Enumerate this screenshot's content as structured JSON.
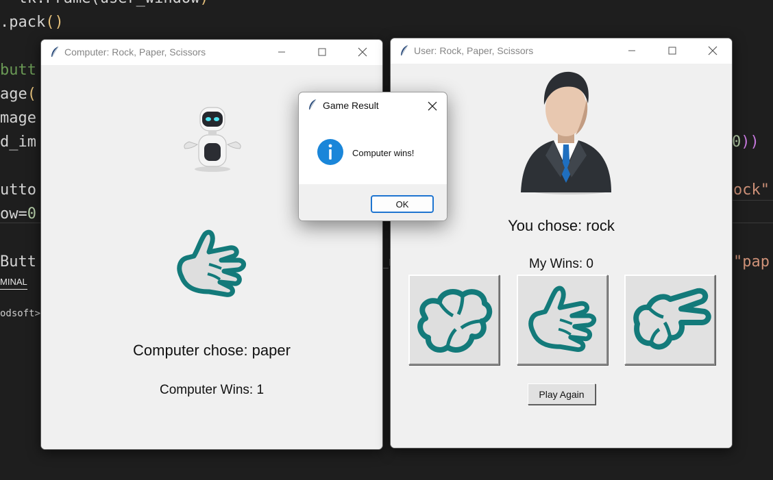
{
  "background_code": {
    "lines": [
      {
        "parts": [
          [
            "= tk.Frame(",
            "w"
          ],
          [
            "user_window",
            "w"
          ],
          [
            ")",
            "y"
          ]
        ]
      },
      {
        "parts": [
          [
            ".pack",
            "w"
          ],
          [
            "()",
            "y"
          ]
        ]
      },
      {
        "parts": [
          [
            "",
            "w"
          ]
        ]
      },
      {
        "parts": [
          [
            "butt",
            "g"
          ]
        ]
      },
      {
        "parts": [
          [
            "age",
            "w"
          ],
          [
            "(",
            "y"
          ]
        ]
      },
      {
        "parts": [
          [
            "mage",
            "w"
          ]
        ]
      },
      {
        "parts": [
          [
            "d_im",
            "w"
          ]
        ]
      },
      {
        "parts": [
          [
            "",
            "w"
          ]
        ]
      },
      {
        "parts": [
          [
            "utto",
            "w"
          ]
        ]
      },
      {
        "parts": [
          [
            "ow=",
            "w"
          ],
          [
            "0",
            "n"
          ]
        ]
      },
      {
        "parts": [
          [
            "",
            "w"
          ]
        ]
      },
      {
        "parts": [
          [
            "Butt",
            "w"
          ]
        ]
      }
    ],
    "right_fragments": [
      {
        "text": "0",
        "cls": "n",
        "paren": "))"
      },
      {
        "text": "ock\"",
        "cls": "o"
      },
      {
        "text": "\"pap",
        "cls": "o"
      }
    ],
    "mid_fragment": "_n",
    "terminal_tab": "MINAL",
    "terminal_text": "odsoft>"
  },
  "computer_window": {
    "title": "Computer: Rock, Paper, Scissors",
    "avatar_icon": "robot-icon",
    "choice_icon": "hand-paper-icon",
    "choice_label": "Computer chose: paper",
    "wins_label": "Computer Wins: 1"
  },
  "user_window": {
    "title": "User: Rock, Paper, Scissors",
    "avatar_icon": "businessman-icon",
    "choice_label": "You chose: rock",
    "wins_label": "My Wins: 0",
    "buttons": [
      {
        "icon": "hand-rock-icon",
        "value": "rock"
      },
      {
        "icon": "hand-paper-icon",
        "value": "paper"
      },
      {
        "icon": "hand-scissors-icon",
        "value": "scissors"
      }
    ],
    "play_again_label": "Play Again"
  },
  "dialog": {
    "title": "Game Result",
    "icon": "info-icon",
    "message": "Computer wins!",
    "ok_label": "OK"
  },
  "colors": {
    "hand_outline": "#137a7a",
    "hand_fill": "#dedede",
    "accent": "#1d74d0",
    "info_icon": "#1a86d9"
  }
}
